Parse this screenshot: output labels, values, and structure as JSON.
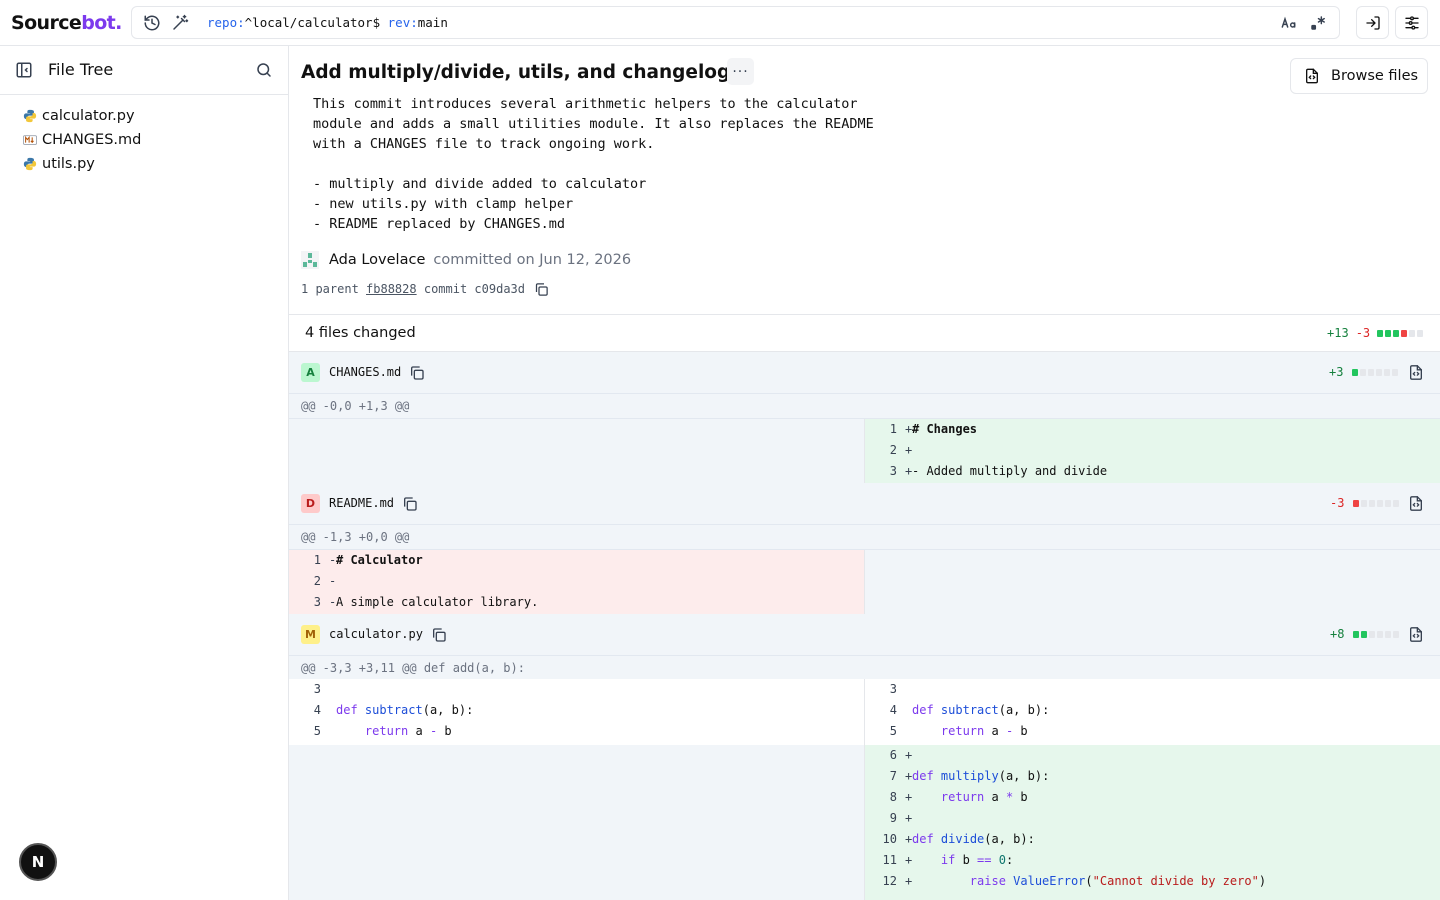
{
  "app": {
    "logo_main": "Source",
    "logo_accent": "bot."
  },
  "search": {
    "q_repo_kw": "repo:",
    "q_repo_val": "^local/calculator$ ",
    "q_rev_kw": "rev:",
    "q_rev_val": "main"
  },
  "sidebar": {
    "title": "File Tree",
    "files": [
      {
        "name": "calculator.py",
        "type": "python"
      },
      {
        "name": "CHANGES.md",
        "type": "markdown"
      },
      {
        "name": "utils.py",
        "type": "python"
      }
    ],
    "user_initial": "N"
  },
  "commit": {
    "title": "Add multiply/divide, utils, and changelog",
    "more_label": "···",
    "browse_label": "Browse files",
    "message": "This commit introduces several arithmetic helpers to the calculator\nmodule and adds a small utilities module. It also replaces the README\nwith a CHANGES file to track ongoing work.\n\n- multiply and divide added to calculator\n- new utils.py with clamp helper\n- README replaced by CHANGES.md",
    "author": "Ada Lovelace",
    "committed_on": "committed on Jun 12, 2026",
    "parent_count": "1 parent",
    "parent_hash": "fb88828",
    "commit_label": "commit c09da3d"
  },
  "summary": {
    "files_changed": "4 files changed",
    "additions": "+13",
    "deletions": "-3"
  },
  "files": [
    {
      "badge": "A",
      "name": "CHANGES.md",
      "stat": "+3",
      "hunk": "@@ -0,0 +1,3 @@"
    },
    {
      "badge": "D",
      "name": "README.md",
      "stat": "-3",
      "hunk": "@@ -1,3 +0,0 @@"
    },
    {
      "badge": "M",
      "name": "calculator.py",
      "stat": "+8",
      "hunk": "@@ -3,3 +3,11 @@ def add(a, b):"
    }
  ],
  "diff": {
    "changes": {
      "right": [
        {
          "n": "1",
          "s": "+",
          "t": "# Changes"
        },
        {
          "n": "2",
          "s": "+",
          "t": ""
        },
        {
          "n": "3",
          "s": "+",
          "t": "- Added multiply and divide"
        }
      ]
    },
    "readme": {
      "left": [
        {
          "n": "1",
          "s": "-",
          "t": "# Calculator"
        },
        {
          "n": "2",
          "s": "-",
          "t": ""
        },
        {
          "n": "3",
          "s": "-",
          "t": "A simple calculator library."
        }
      ]
    },
    "calc": {
      "ctx": [
        {
          "n": "3",
          "t": ""
        },
        {
          "n": "4",
          "t": "def subtract(a, b):"
        },
        {
          "n": "5",
          "t": "    return a - b"
        }
      ],
      "added": [
        {
          "n": "6",
          "t": ""
        },
        {
          "n": "7",
          "t": "def multiply(a, b):"
        },
        {
          "n": "8",
          "t": "    return a * b"
        },
        {
          "n": "9",
          "t": ""
        },
        {
          "n": "10",
          "t": "def divide(a, b):"
        },
        {
          "n": "11",
          "t": "    if b == 0:"
        },
        {
          "n": "12",
          "t": "        raise ValueError(\"Cannot divide by zero\")"
        }
      ],
      "sign": "+"
    }
  }
}
